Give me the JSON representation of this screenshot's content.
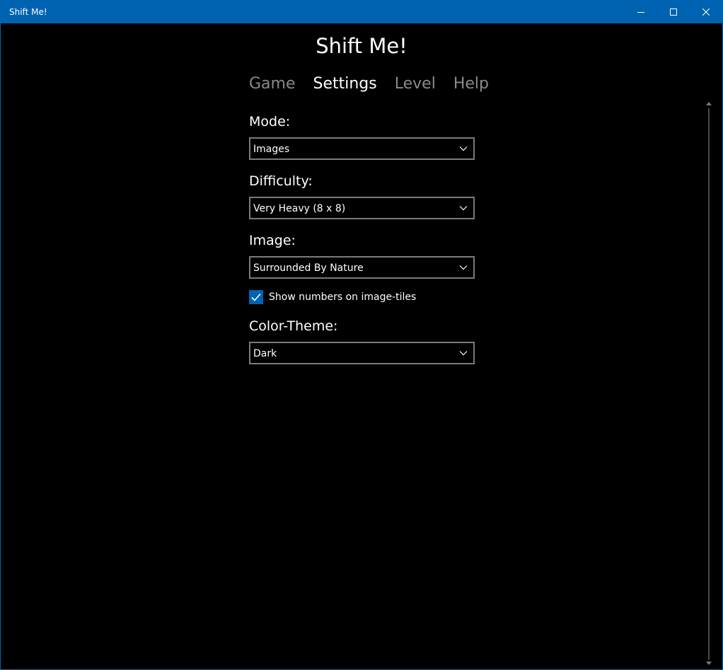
{
  "window": {
    "title": "Shift Me!",
    "accent": "#0063b1"
  },
  "app": {
    "title": "Shift Me!"
  },
  "tabs": [
    {
      "label": "Game",
      "active": false
    },
    {
      "label": "Settings",
      "active": true
    },
    {
      "label": "Level",
      "active": false
    },
    {
      "label": "Help",
      "active": false
    }
  ],
  "settings": {
    "mode": {
      "label": "Mode:",
      "value": "Images"
    },
    "difficulty": {
      "label": "Difficulty:",
      "value": "Very Heavy (8 x 8)"
    },
    "image": {
      "label": "Image:",
      "value": "Surrounded By Nature"
    },
    "show_numbers": {
      "label": "Show numbers on image-tiles",
      "checked": true
    },
    "color_theme": {
      "label": "Color-Theme:",
      "value": "Dark"
    }
  },
  "icons": {
    "minimize": "minimize-icon",
    "maximize": "maximize-icon",
    "close": "close-icon",
    "chevron": "chevron-down-icon",
    "check": "checkmark-icon"
  }
}
